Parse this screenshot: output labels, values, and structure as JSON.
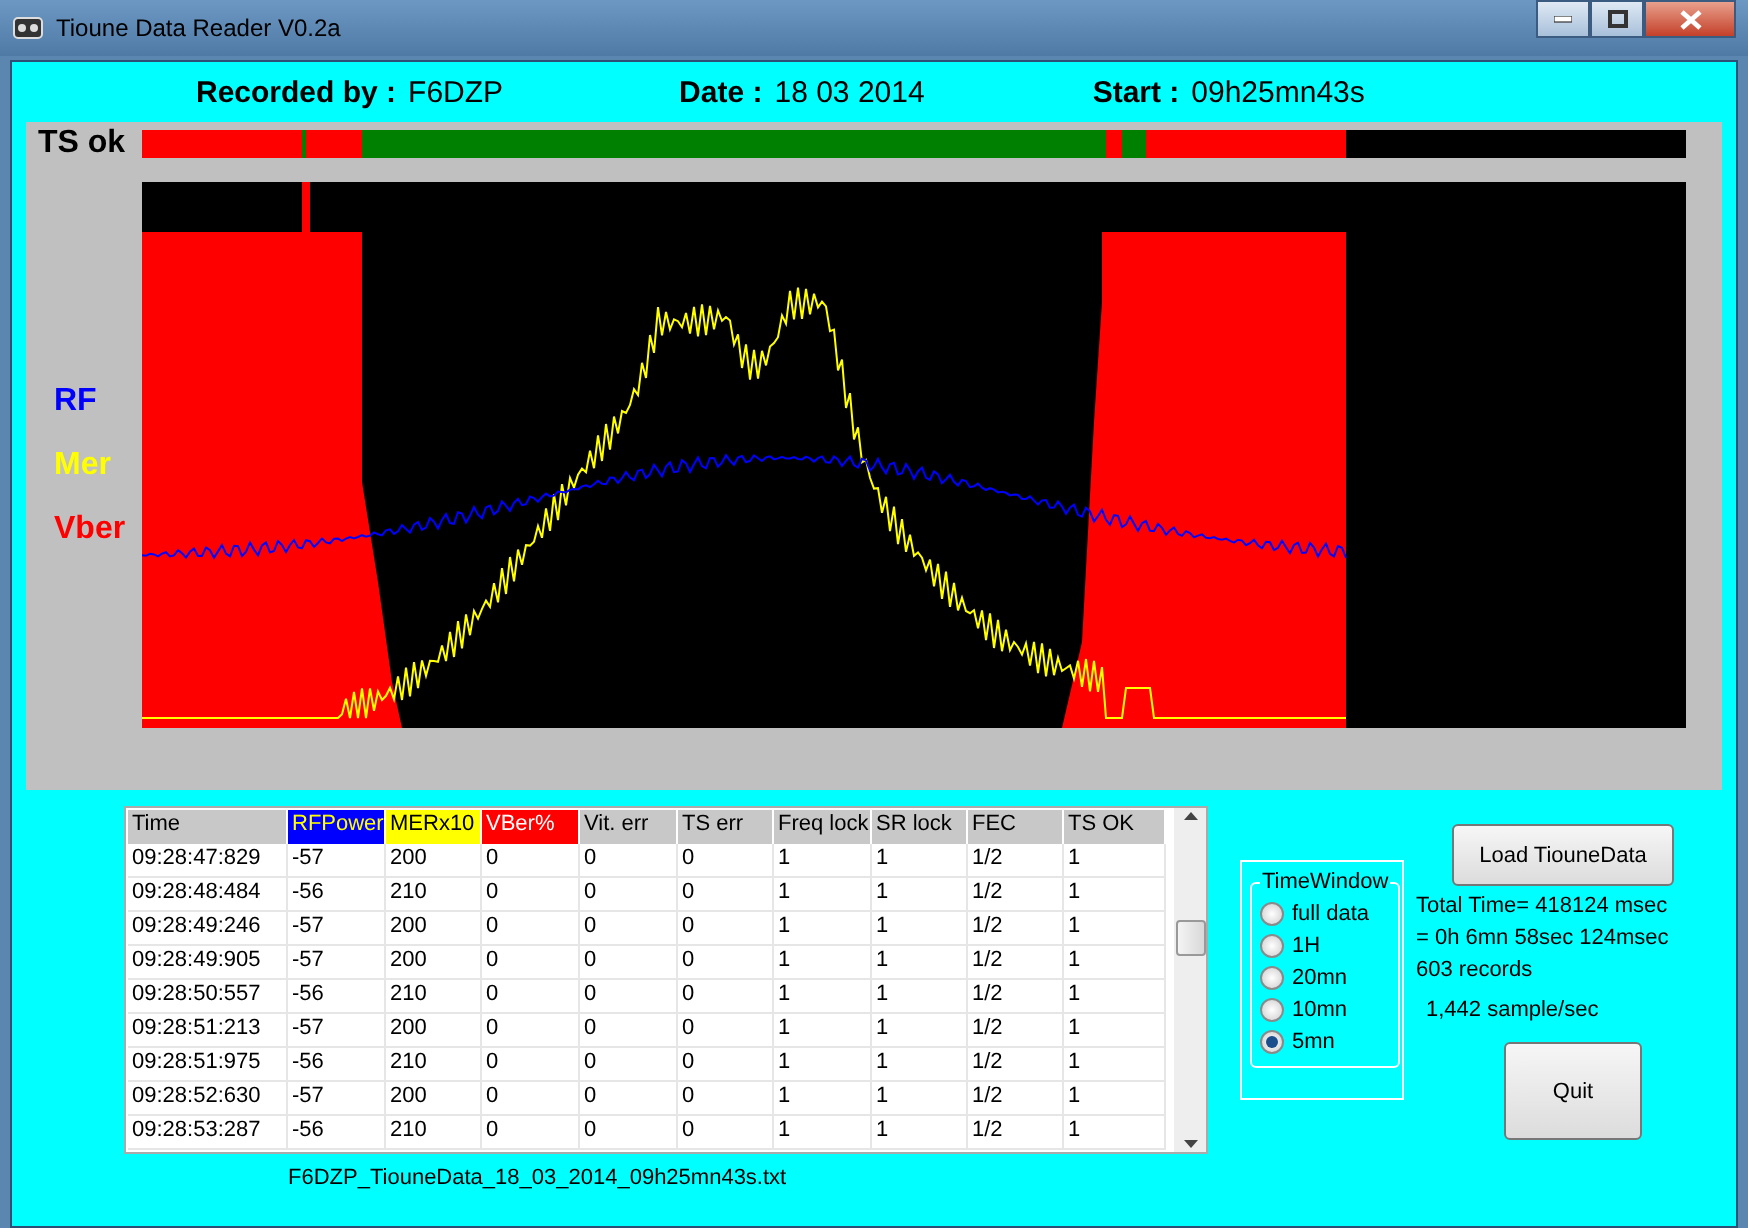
{
  "window": {
    "title": "Tioune Data Reader V0.2a"
  },
  "header": [
    {
      "label": "Recorded by :",
      "value": "F6DZP"
    },
    {
      "label": "Date :",
      "value": "18 03 2014"
    },
    {
      "label": "Start :",
      "value": "09h25mn43s"
    }
  ],
  "ts_label": "TS ok",
  "legend": [
    {
      "label": "RF",
      "color": "#0000ff"
    },
    {
      "label": "Mer",
      "color": "#ffff00"
    },
    {
      "label": "Vber",
      "color": "#ff0000"
    }
  ],
  "table": {
    "columns": [
      {
        "label": "Time"
      },
      {
        "label": "RFPower",
        "color": "#0000ff"
      },
      {
        "label": "MERx10",
        "color": "#ffff00"
      },
      {
        "label": "VBer%",
        "color": "#ff0000"
      },
      {
        "label": "Vit. err"
      },
      {
        "label": "TS err"
      },
      {
        "label": "Freq lock"
      },
      {
        "label": "SR lock"
      },
      {
        "label": "FEC"
      },
      {
        "label": "TS OK"
      }
    ],
    "rows": [
      [
        "09:28:47:829",
        "-57",
        "200",
        "0",
        "0",
        "0",
        "1",
        "1",
        "1/2",
        "1"
      ],
      [
        "09:28:48:484",
        "-56",
        "210",
        "0",
        "0",
        "0",
        "1",
        "1",
        "1/2",
        "1"
      ],
      [
        "09:28:49:246",
        "-57",
        "200",
        "0",
        "0",
        "0",
        "1",
        "1",
        "1/2",
        "1"
      ],
      [
        "09:28:49:905",
        "-57",
        "200",
        "0",
        "0",
        "0",
        "1",
        "1",
        "1/2",
        "1"
      ],
      [
        "09:28:50:557",
        "-56",
        "210",
        "0",
        "0",
        "0",
        "1",
        "1",
        "1/2",
        "1"
      ],
      [
        "09:28:51:213",
        "-57",
        "200",
        "0",
        "0",
        "0",
        "1",
        "1",
        "1/2",
        "1"
      ],
      [
        "09:28:51:975",
        "-56",
        "210",
        "0",
        "0",
        "0",
        "1",
        "1",
        "1/2",
        "1"
      ],
      [
        "09:28:52:630",
        "-57",
        "200",
        "0",
        "0",
        "0",
        "1",
        "1",
        "1/2",
        "1"
      ],
      [
        "09:28:53:287",
        "-56",
        "210",
        "0",
        "0",
        "0",
        "1",
        "1",
        "1/2",
        "1"
      ]
    ]
  },
  "filename": "F6DZP_TiouneData_18_03_2014_09h25mn43s.txt",
  "time_window": {
    "title": "TimeWindow",
    "options": [
      {
        "label": "full data",
        "selected": false
      },
      {
        "label": "1H",
        "selected": false
      },
      {
        "label": "20mn",
        "selected": false
      },
      {
        "label": "10mn",
        "selected": false
      },
      {
        "label": "5mn",
        "selected": true
      }
    ]
  },
  "load_button": "Load TiouneData",
  "stats": [
    "Total Time= 418124 msec",
    "= 0h 6mn 58sec 124msec",
    "603 records",
    "1,442 sample/sec"
  ],
  "quit_button": "Quit"
}
